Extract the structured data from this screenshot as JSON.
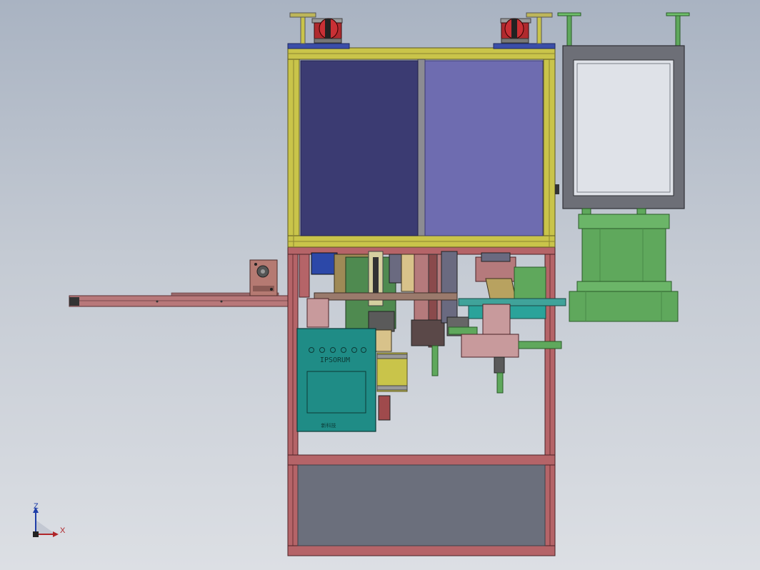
{
  "viewport": {
    "background_top": "#a9b3c2",
    "background_bottom": "#dcdfe4"
  },
  "control_cabinet": {
    "label": "IPSORUM",
    "footer_label": "新科技",
    "color": "#1f8c86",
    "buttons_count": 6
  },
  "triad": {
    "z_label": "Z",
    "x_label": "X"
  },
  "colors": {
    "yellow_frame": "#c9c44a",
    "upper_left_panel": "#3b3b72",
    "upper_right_panel": "#6e6cb0",
    "red_frame": "#a8545a",
    "green_part": "#5fa85c",
    "lower_panel": "#6b6f7c",
    "grey_frame": "#6d6f77",
    "teal_plate": "#2aa39a"
  }
}
